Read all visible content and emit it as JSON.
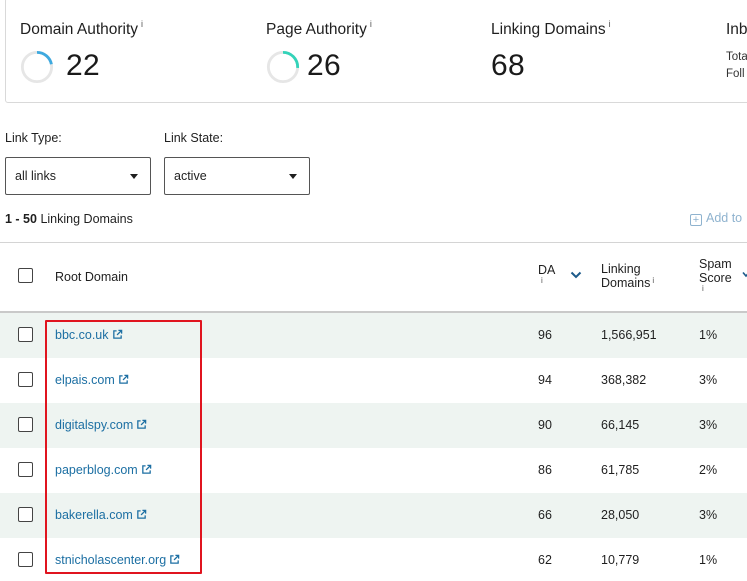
{
  "metrics": {
    "domain_authority": {
      "title": "Domain Authority",
      "info": "i",
      "value": "22",
      "ring_fraction": 0.22
    },
    "page_authority": {
      "title": "Page Authority",
      "info": "i",
      "value": "26",
      "ring_fraction": 0.26
    },
    "linking_domains": {
      "title": "Linking Domains",
      "info": "i",
      "value": "68"
    },
    "inbound": {
      "title": "Inb",
      "line1": "Tota",
      "line2": "Foll"
    }
  },
  "colors": {
    "ring_da": "#3ea9df",
    "ring_pa": "#33d3b9",
    "ring_track": "#e6e6e6",
    "link": "#1c6fa3",
    "highlight": "#e0141f",
    "row_shade": "#eef4f1"
  },
  "filters": {
    "link_type": {
      "label": "Link Type:",
      "value": "all links"
    },
    "link_state": {
      "label": "Link State:",
      "value": "active"
    }
  },
  "range": {
    "count": "1 - 50",
    "label": "Linking Domains"
  },
  "add_to": {
    "icon": "plus-square-icon",
    "label": "Add to"
  },
  "table": {
    "headers": {
      "root_domain": "Root Domain",
      "da": "DA",
      "da_info": "i",
      "linking_domains_line1": "Linking",
      "linking_domains_line2": "Domains",
      "linking_domains_info": "i",
      "spam_line1": "Spam",
      "spam_line2": "Score",
      "spam_info": "i"
    },
    "rows": [
      {
        "domain": "bbc.co.uk",
        "da": "96",
        "linking_domains": "1,566,951",
        "spam": "1%"
      },
      {
        "domain": "elpais.com",
        "da": "94",
        "linking_domains": "368,382",
        "spam": "3%"
      },
      {
        "domain": "digitalspy.com",
        "da": "90",
        "linking_domains": "66,145",
        "spam": "3%"
      },
      {
        "domain": "paperblog.com",
        "da": "86",
        "linking_domains": "61,785",
        "spam": "2%"
      },
      {
        "domain": "bakerella.com",
        "da": "66",
        "linking_domains": "28,050",
        "spam": "3%"
      },
      {
        "domain": "stnicholascenter.org",
        "da": "62",
        "linking_domains": "10,779",
        "spam": "1%"
      }
    ]
  }
}
